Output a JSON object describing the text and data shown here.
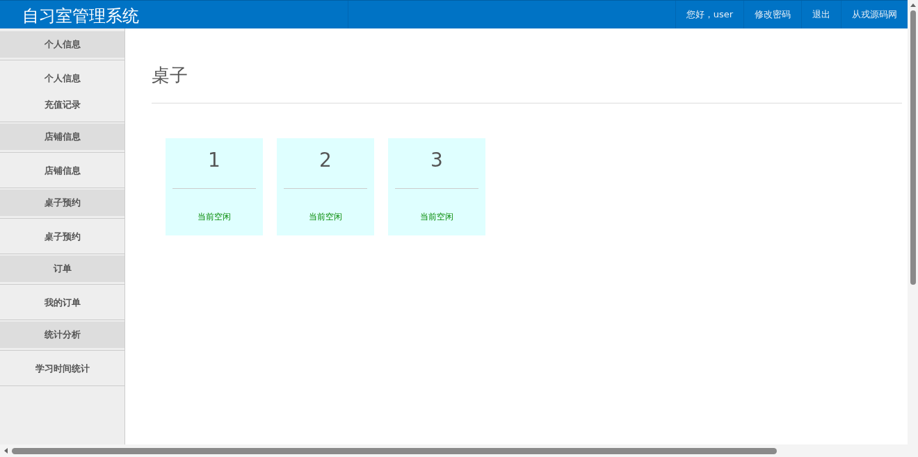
{
  "header": {
    "title": "自习室管理系统",
    "greeting": "您好，user",
    "links": [
      "修改密码",
      "退出",
      "从戎源码网"
    ]
  },
  "sidebar": {
    "groups": [
      {
        "title": "个人信息",
        "items": [
          {
            "label": "个人信息"
          },
          {
            "label": "充值记录"
          }
        ]
      },
      {
        "title": "店铺信息",
        "items": [
          {
            "label": "店铺信息"
          }
        ]
      },
      {
        "title": "桌子预约",
        "items": [
          {
            "label": "桌子预约"
          }
        ]
      },
      {
        "title": "订单",
        "items": [
          {
            "label": "我的订单"
          }
        ]
      },
      {
        "title": "统计分析",
        "items": [
          {
            "label": "学习时间统计"
          }
        ]
      }
    ]
  },
  "main": {
    "title": "桌子",
    "tables": [
      {
        "number": "1",
        "status": "当前空闲"
      },
      {
        "number": "2",
        "status": "当前空闲"
      },
      {
        "number": "3",
        "status": "当前空闲"
      }
    ]
  }
}
